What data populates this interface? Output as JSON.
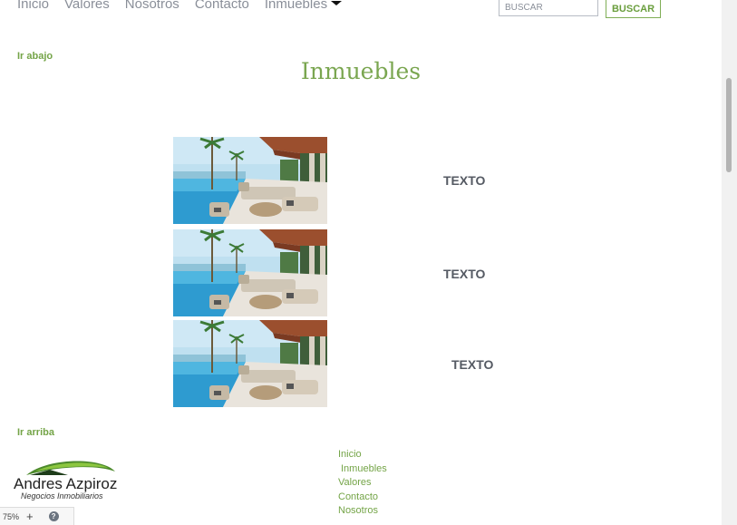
{
  "nav": {
    "items": [
      {
        "label": "Inicio"
      },
      {
        "label": "Valores"
      },
      {
        "label": "Nosotros"
      },
      {
        "label": "Contacto"
      },
      {
        "label": "Inmuebles"
      }
    ]
  },
  "search": {
    "placeholder": "BUSCAR",
    "button_label": "BUSCAR"
  },
  "links": {
    "down": "Ir abajo",
    "up": "Ir arriba"
  },
  "main": {
    "title": "Inmuebles",
    "properties": [
      {
        "text": "TEXTO"
      },
      {
        "text": "TEXTO"
      },
      {
        "text": "TEXTO"
      }
    ]
  },
  "footer": {
    "logo": {
      "name": "Andres Azpiroz",
      "tagline": "Negocios Inmobiliarios"
    },
    "links": [
      "Inicio",
      "Inmuebles",
      "Valores",
      "Contacto",
      "Nosotros"
    ]
  },
  "status": {
    "zoom": "75%",
    "plus": "+",
    "help": "?"
  },
  "colors": {
    "accent": "#7aa650",
    "text": "#555a63",
    "nav": "#8a8f99"
  },
  "icons": [
    "caret-down-icon",
    "help-icon",
    "logo-hill-icon"
  ]
}
